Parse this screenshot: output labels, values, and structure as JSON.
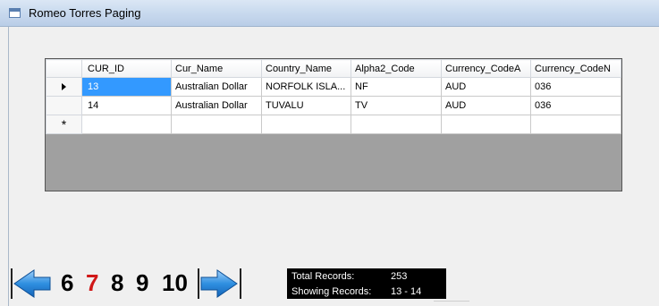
{
  "window": {
    "title": "Romeo Torres Paging"
  },
  "grid": {
    "columns": [
      "CUR_ID",
      "Cur_Name",
      "Country_Name",
      "Alpha2_Code",
      "Currency_CodeA",
      "Currency_CodeN"
    ],
    "rows": [
      [
        "13",
        "Australian Dollar",
        "NORFOLK ISLA...",
        "NF",
        "AUD",
        "036"
      ],
      [
        "14",
        "Australian Dollar",
        "TUVALU",
        "TV",
        "AUD",
        "036"
      ]
    ],
    "new_row_marker": "*"
  },
  "pager": {
    "pages": [
      "6",
      "7",
      "8",
      "9",
      "10"
    ],
    "current_page": "7",
    "prev_icon": "left-arrow-icon",
    "next_icon": "right-arrow-icon"
  },
  "info": {
    "total_label": "Total Records:",
    "total_value": "253",
    "showing_label": "Showing Records:",
    "showing_value": "13 - 14"
  },
  "colors": {
    "selection": "#3399ff",
    "current_page": "#d01818",
    "nav_arrow": "#2f8fe0"
  }
}
